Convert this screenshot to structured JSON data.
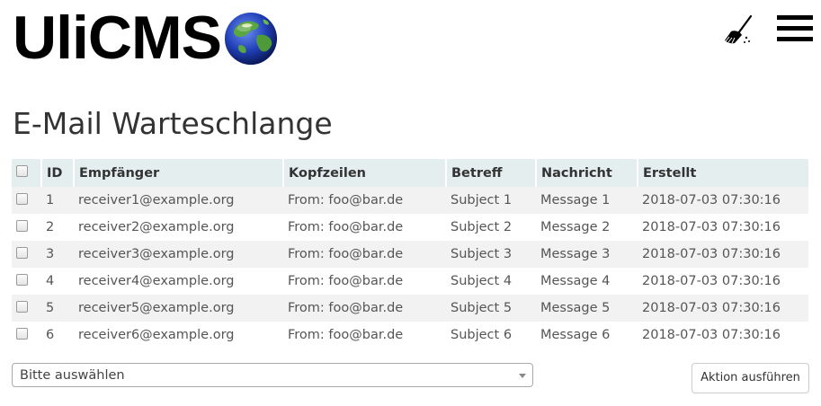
{
  "header": {
    "logo_text": "UliCMS",
    "logo_icon": "globe-icon",
    "clear_cache_icon": "broom-icon",
    "menu_icon": "hamburger-menu-icon"
  },
  "page": {
    "title": "E-Mail Warteschlange"
  },
  "table": {
    "columns": [
      "ID",
      "Empfänger",
      "Kopfzeilen",
      "Betreff",
      "Nachricht",
      "Erstellt"
    ],
    "rows": [
      {
        "id": "1",
        "recipient": "receiver1@example.org",
        "headers": "From: foo@bar.de",
        "subject": "Subject 1",
        "message": "Message 1",
        "created": "2018-07-03 07:30:16"
      },
      {
        "id": "2",
        "recipient": "receiver2@example.org",
        "headers": "From: foo@bar.de",
        "subject": "Subject 2",
        "message": "Message 2",
        "created": "2018-07-03 07:30:16"
      },
      {
        "id": "3",
        "recipient": "receiver3@example.org",
        "headers": "From: foo@bar.de",
        "subject": "Subject 3",
        "message": "Message 3",
        "created": "2018-07-03 07:30:16"
      },
      {
        "id": "4",
        "recipient": "receiver4@example.org",
        "headers": "From: foo@bar.de",
        "subject": "Subject 4",
        "message": "Message 4",
        "created": "2018-07-03 07:30:16"
      },
      {
        "id": "5",
        "recipient": "receiver5@example.org",
        "headers": "From: foo@bar.de",
        "subject": "Subject 5",
        "message": "Message 5",
        "created": "2018-07-03 07:30:16"
      },
      {
        "id": "6",
        "recipient": "receiver6@example.org",
        "headers": "From: foo@bar.de",
        "subject": "Subject 6",
        "message": "Message 6",
        "created": "2018-07-03 07:30:16"
      }
    ]
  },
  "actions": {
    "select_value": "Bitte auswählen",
    "run_button_label": "Aktion ausführen"
  },
  "colors": {
    "header_row_bg": "#e5eeee",
    "odd_row_bg": "#f2f2f2"
  }
}
